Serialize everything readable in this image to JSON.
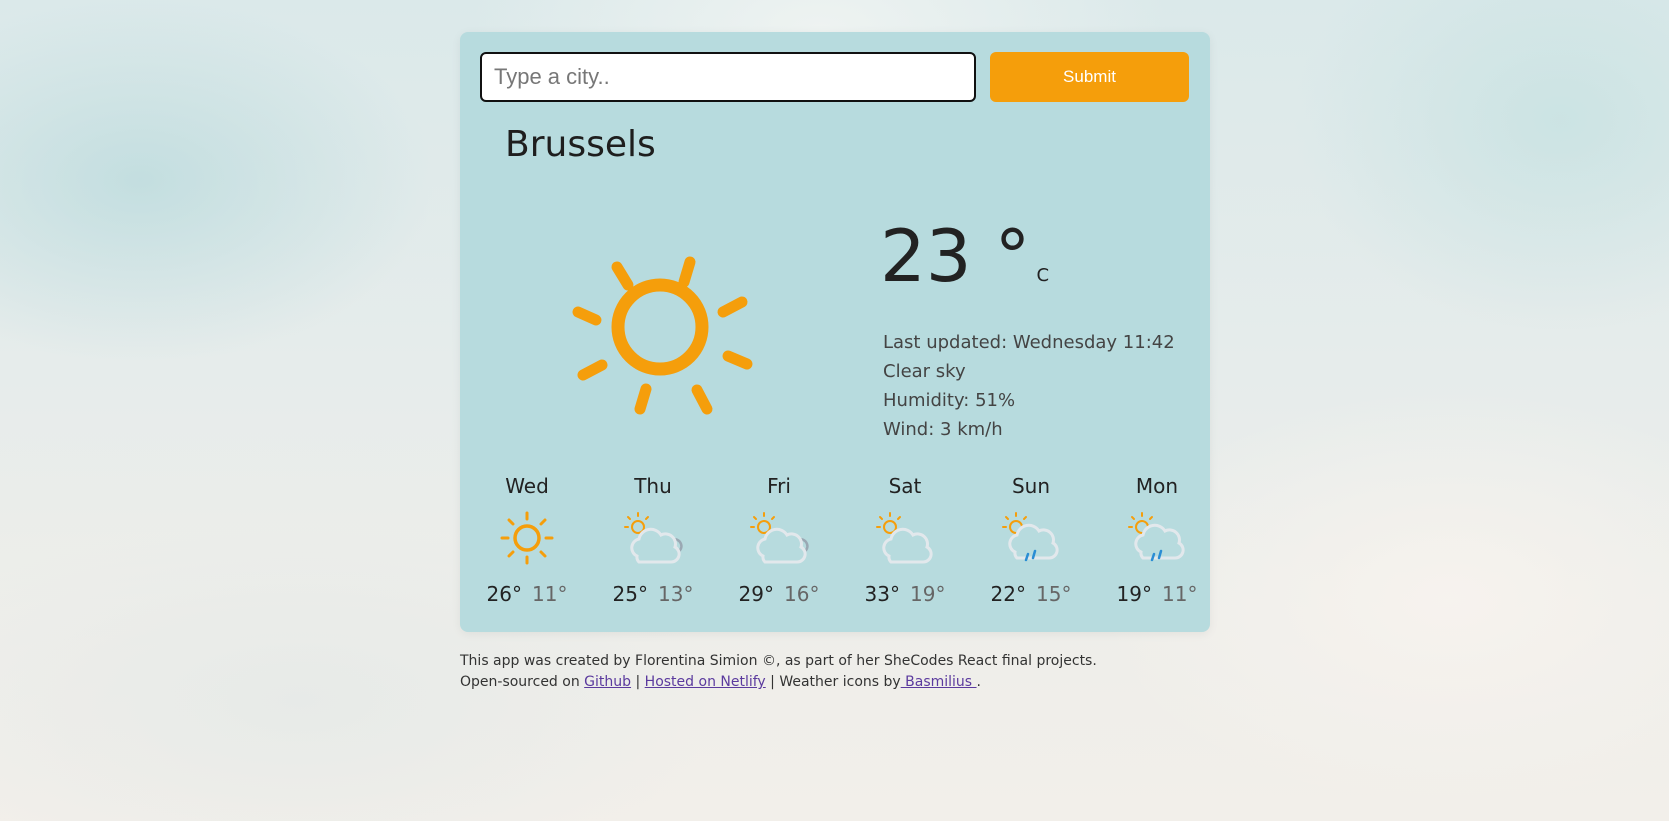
{
  "search": {
    "placeholder": "Type a city..",
    "value": "",
    "submit_label": "Submit"
  },
  "current": {
    "city": "Brussels",
    "temperature": "23 °",
    "unit": "C",
    "icon": "sun-icon",
    "last_updated": "Last updated: Wednesday 11:42",
    "description": "Clear sky",
    "humidity": "Humidity: 51%",
    "wind": "Wind: 3 km/h"
  },
  "forecast": [
    {
      "day": "Wed",
      "max": "26°",
      "min": "11°",
      "icon": "sun-icon"
    },
    {
      "day": "Thu",
      "max": "25°",
      "min": "13°",
      "icon": "partly-cloudy-icon"
    },
    {
      "day": "Fri",
      "max": "29°",
      "min": "16°",
      "icon": "partly-cloudy-icon"
    },
    {
      "day": "Sat",
      "max": "33°",
      "min": "19°",
      "icon": "partly-cloudy-day-icon"
    },
    {
      "day": "Sun",
      "max": "22°",
      "min": "15°",
      "icon": "partly-cloudy-rain-icon"
    },
    {
      "day": "Mon",
      "max": "19°",
      "min": "11°",
      "icon": "partly-cloudy-rain-icon"
    }
  ],
  "footer": {
    "line1": "This app was created by Florentina Simion ©, as part of her SheCodes React final projects.",
    "open_sourced_prefix": "Open-sourced on ",
    "github_link": "Github",
    "separator": " | ",
    "netlify_link": "Hosted on Netlify",
    "icons_prefix": " | Weather icons by",
    "basmilius_link": " Basmilius ",
    "end": "."
  },
  "colors": {
    "accent": "#f59e0b",
    "card_background": "#b7dbde",
    "sun": "#f59e0b",
    "rain": "#2a8dd4",
    "cloud_stroke": "#e2e8ec"
  }
}
